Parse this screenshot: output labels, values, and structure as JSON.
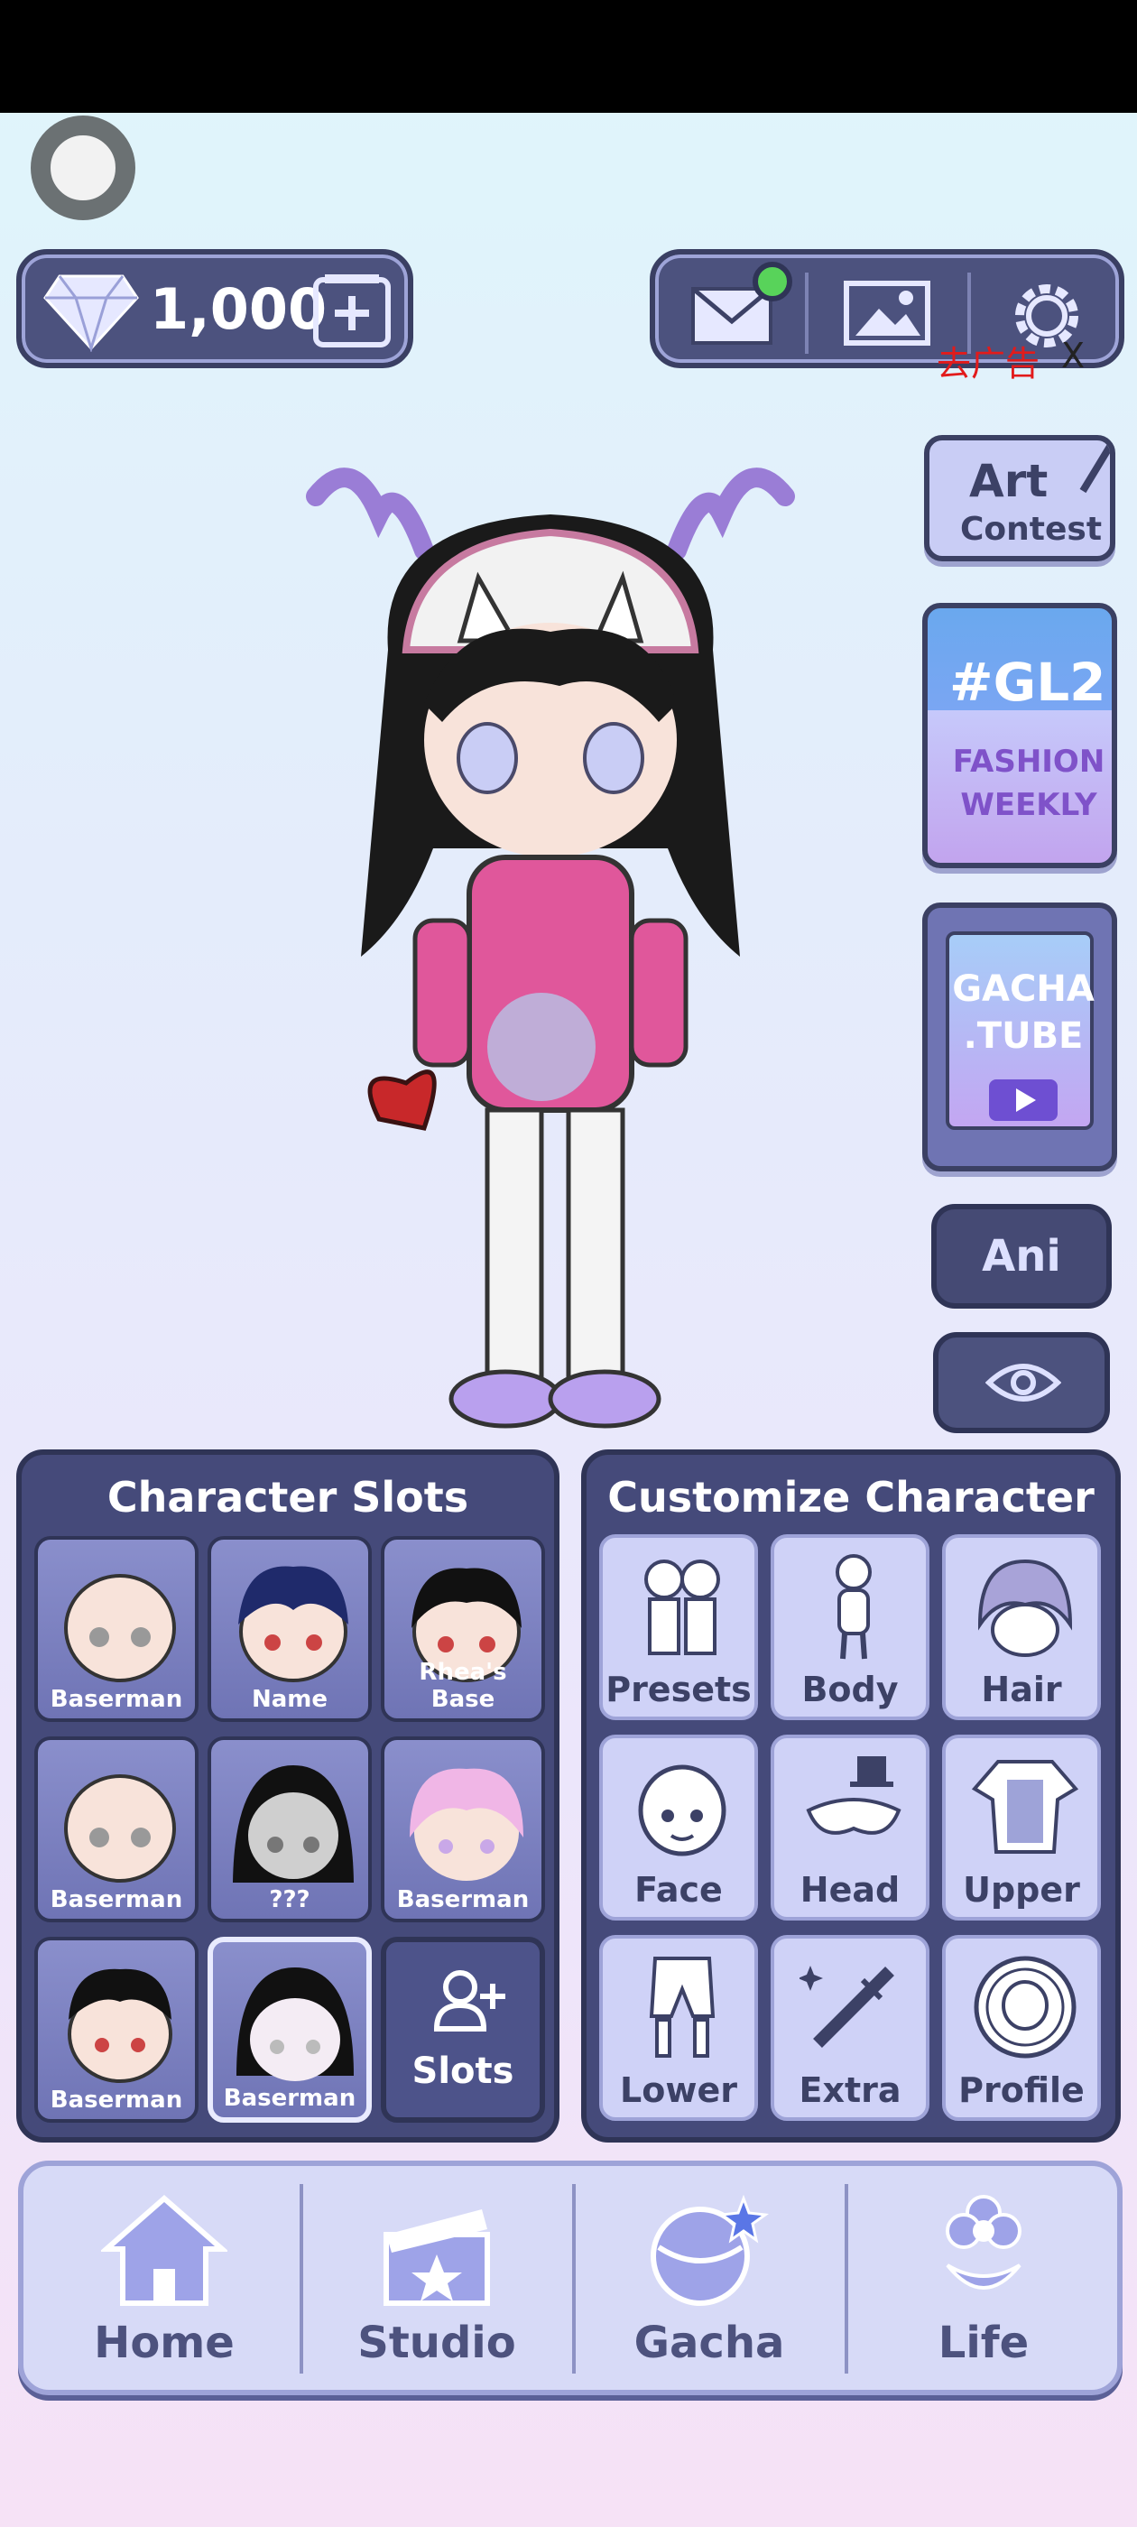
{
  "currency": {
    "gems": "1,000"
  },
  "ad": {
    "label": "去广告",
    "close": "X"
  },
  "side": {
    "art_contest": {
      "line1": "Art",
      "line2": "Contest"
    },
    "gl2": {
      "tag": "#GL2",
      "line1": "FASHION",
      "line2": "WEEKLY"
    },
    "tube": {
      "line1": "GACHA",
      "line2": ".TUBE"
    },
    "ani": "Ani"
  },
  "slots": {
    "title": "Character Slots",
    "items": [
      {
        "label": "Baserman"
      },
      {
        "label": "Name"
      },
      {
        "label": "Rhea's Base"
      },
      {
        "label": "Baserman"
      },
      {
        "label": "???"
      },
      {
        "label": "Baserman"
      },
      {
        "label": "Baserman"
      },
      {
        "label": "Baserman"
      }
    ],
    "add_label": "Slots"
  },
  "customize": {
    "title": "Customize Character",
    "items": [
      {
        "label": "Presets"
      },
      {
        "label": "Body"
      },
      {
        "label": "Hair"
      },
      {
        "label": "Face"
      },
      {
        "label": "Head"
      },
      {
        "label": "Upper"
      },
      {
        "label": "Lower"
      },
      {
        "label": "Extra"
      },
      {
        "label": "Profile"
      }
    ]
  },
  "nav": {
    "items": [
      {
        "label": "Home"
      },
      {
        "label": "Studio"
      },
      {
        "label": "Gacha"
      },
      {
        "label": "Life"
      }
    ]
  },
  "colors": {
    "panel": "#454a7a",
    "accent": "#58d35a",
    "ad": "#e21b1b"
  }
}
